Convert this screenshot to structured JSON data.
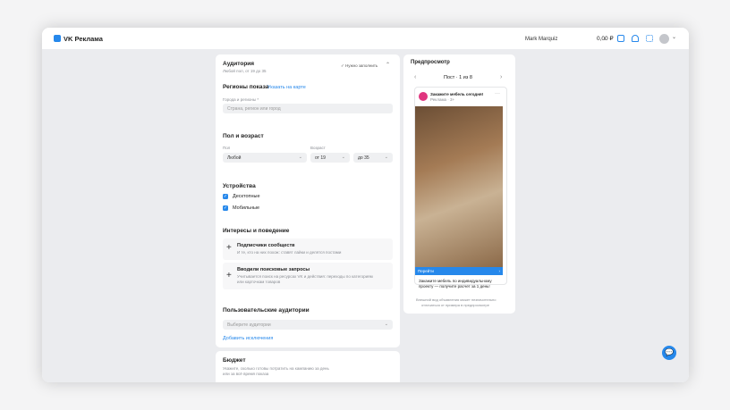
{
  "header": {
    "logo": "VK Реклама",
    "account": "Mark Marquiz",
    "balance": "0,00 ₽"
  },
  "audience": {
    "title": "Аудитория",
    "subtitle": "Любой пол, от 19 до 35",
    "badge": "✓ Нужно заполнить",
    "regions": {
      "title": "Регионы показа",
      "map_link": "Указать на карте",
      "label": "Города и регионы *",
      "placeholder": "Страна, регион или город"
    },
    "sexage": {
      "title": "Пол и возраст",
      "sex_label": "Пол",
      "sex_value": "Любой",
      "age_label": "Возраст",
      "from_prefix": "от",
      "from_value": "19",
      "to_prefix": "до",
      "to_value": "35"
    },
    "devices": {
      "title": "Устройства",
      "items": [
        "Десктопные",
        "Мобильные"
      ]
    },
    "interests": {
      "title": "Интересы и поведение",
      "items": [
        {
          "title": "Подписчики сообществ",
          "desc": "И те, кто на них похож: ставят лайки и делятся постами"
        },
        {
          "title": "Вводили поисковые запросы",
          "desc": "Учитывается поиск на ресурсах VK и действия: переходы по категориям",
          "desc2": "или карточкам товаров"
        }
      ]
    },
    "custom": {
      "title": "Пользовательские аудитории",
      "placeholder": "Выберите аудитории",
      "exclude_link": "Добавить исключения"
    }
  },
  "budget": {
    "title": "Бюджет",
    "desc": "Укажите, сколько готовы потратить на кампанию за день",
    "desc2": "или за всё время показа"
  },
  "preview": {
    "title": "Предпросмотр",
    "selector": "Пост · 1 из 8",
    "post_title": "Закажите мебель сегодня!",
    "post_meta": "Реклама · 3+",
    "cta": "Перейти",
    "text": "Закажите мебель по индивидуальному",
    "text2": "проекту — получите расчет за 1 день!",
    "note": "Внешний вид объявления может незначительно",
    "note2": "отличаться от примера в предпросмотре"
  }
}
